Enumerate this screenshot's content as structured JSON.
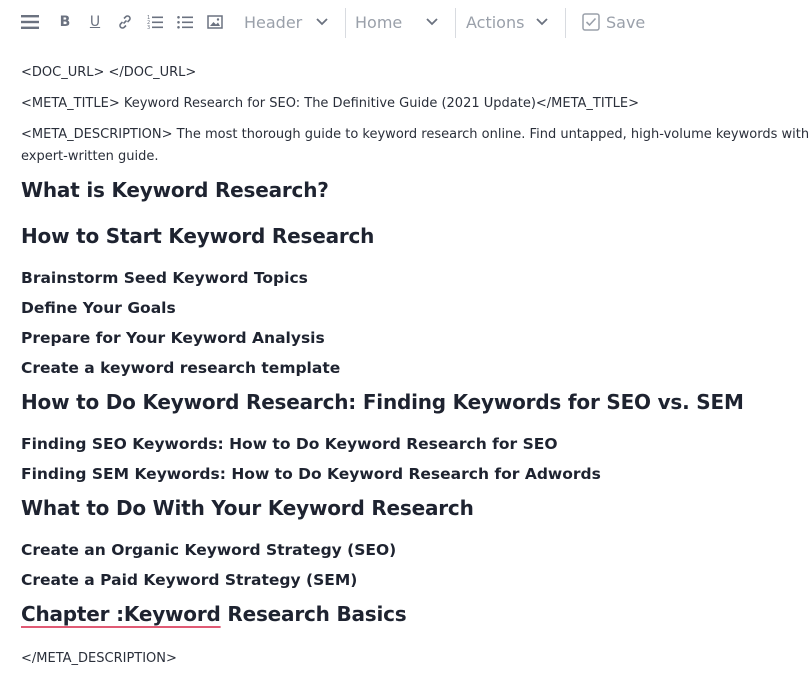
{
  "toolbar": {
    "icons": [
      "menu-icon",
      "bold-icon",
      "underline-icon",
      "link-icon",
      "ordered-list-icon",
      "unordered-list-icon",
      "image-icon"
    ],
    "bold_label": "B",
    "underline_label": "U",
    "header_select": "Header",
    "home_select": "Home",
    "actions_select": "Actions",
    "save_label": "Save",
    "icon_color": "#6b7280",
    "muted_color": "#9aa0aa"
  },
  "document": {
    "doc_url_line": "<DOC_URL> </DOC_URL>",
    "meta_title_line": "<META_TITLE> Keyword Research for SEO: The Definitive Guide (2021 Update)</META_TITLE>",
    "meta_description_line": "<META_DESCRIPTION> The most thorough guide to keyword research online. Find untapped, high-volume keywords with this expert-written guide.",
    "headings": [
      {
        "level": "h2",
        "text": "What is Keyword Research?"
      },
      {
        "level": "h2",
        "text": "How to Start Keyword Research"
      },
      {
        "level": "h3",
        "text": "Brainstorm Seed Keyword Topics"
      },
      {
        "level": "h3",
        "text": "Define Your Goals"
      },
      {
        "level": "h3",
        "text": "Prepare for Your Keyword Analysis"
      },
      {
        "level": "h3",
        "text": "Create a keyword research template"
      },
      {
        "level": "h2",
        "text": "How to Do Keyword Research: Finding Keywords for SEO vs. SEM"
      },
      {
        "level": "h3",
        "text": "Finding SEO Keywords: How to Do Keyword Research for SEO"
      },
      {
        "level": "h3",
        "text": "Finding SEM Keywords: How to Do Keyword Research for Adwords"
      },
      {
        "level": "h2",
        "text": "What to Do With Your Keyword Research"
      },
      {
        "level": "h3",
        "text": "Create an Organic Keyword Strategy (SEO)"
      },
      {
        "level": "h3",
        "text": "Create a Paid Keyword Strategy (SEM)"
      }
    ],
    "chapter": {
      "misspelled_part": "Chapter :Keyword",
      "rest": " Research Basics"
    },
    "closing_line": "</META_DESCRIPTION>",
    "spellcheck_color": "#e05a74"
  }
}
